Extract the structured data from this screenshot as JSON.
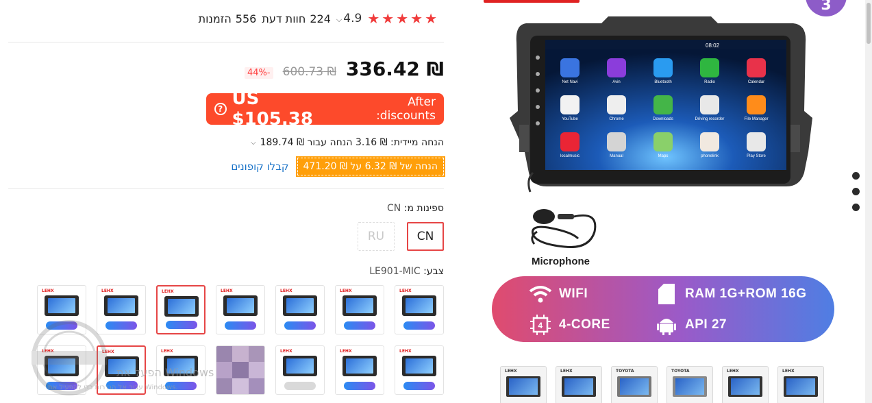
{
  "rating": {
    "value": "4.9",
    "stars": 5
  },
  "reviews": {
    "count": "224",
    "label": "חוות דעת"
  },
  "orders": {
    "count": "556",
    "label": "הזמנות"
  },
  "price": {
    "current": "₪ 336.42",
    "original": "₪ 600.73",
    "discount": "-44%"
  },
  "after_discount": {
    "label": "After discounts:",
    "amount": "US $105.38"
  },
  "instant": {
    "text": "הנחה מיידית: ₪ 3.16 הנחה עבור ₪ 189.74"
  },
  "coupon": {
    "tag": "הנחה של ₪ 6.32 על ₪ 471.20",
    "link": "קבלו קופונים"
  },
  "shipping": {
    "label": "ספינות מ:",
    "value": "CN",
    "options": [
      "CN",
      "RU"
    ]
  },
  "color": {
    "label": "צבע:",
    "value": "LE901-MIC"
  },
  "gallery": {
    "mic_label": "Microphone",
    "specs": [
      "WIFI",
      "RAM 1G+ROM 16G",
      "4-CORE",
      "API 27"
    ],
    "time": "08:02",
    "apps": [
      "Net Navi",
      "Avin",
      "Bluetooth",
      "Radio",
      "Calendar",
      "YouTube",
      "Chrome",
      "Downloads",
      "Driving recorder",
      "File Manager",
      "localmusic",
      "Manual",
      "Maps",
      "phonelink",
      "Play Store"
    ]
  },
  "watermark": {
    "line1": "הפעל את Windows",
    "line2": "עבור אל הגדרות כדי להפעיל את Windows."
  },
  "colors": {
    "accent": "#fd4a2b",
    "star": "#f03b3b",
    "coupon": "#ff9f0a",
    "link": "#1a73c8"
  }
}
